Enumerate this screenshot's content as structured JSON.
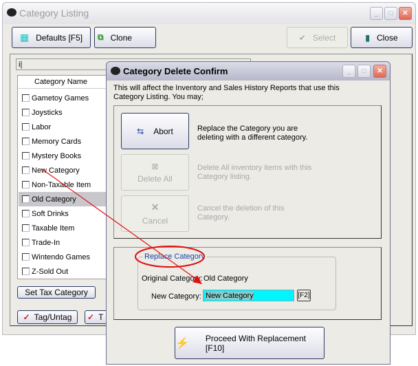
{
  "main_window": {
    "title": "Category Listing",
    "toolbar": {
      "defaults": "Defaults [F5]",
      "clone": "Clone",
      "select": "Select",
      "close": "Close"
    },
    "search_value": "i|",
    "column_header": "Category Name",
    "categories": [
      "Gametoy Games",
      "Joysticks",
      "Labor",
      "Memory Cards",
      "Mystery Books",
      "New Category",
      "Non-Taxable Item",
      "Old Category",
      "Soft Drinks",
      "Taxable Item",
      "Trade-In",
      "Wintendo Games",
      "Z-Sold Out"
    ],
    "selected_category": "Old Category",
    "set_tax_category": "Set Tax Category",
    "tag_untag": "Tag/Untag",
    "tag_second": "T"
  },
  "dialog": {
    "title": "Category Delete Confirm",
    "message": "This will affect the Inventory and Sales History Reports that use this Category Listing.  You may;",
    "options": [
      {
        "label": "Abort",
        "description": "Replace the Category you are deleting with a different category.",
        "enabled": true
      },
      {
        "label": "Delete All",
        "description": "Delete All inventory items with this Category listing.",
        "enabled": false
      },
      {
        "label": "Cancel",
        "description": "Cancel the deletion of this Category.",
        "enabled": false
      }
    ],
    "group_title": "Replace Category",
    "original_label": "Original Category:",
    "original_value": "Old Category",
    "new_label": "New Category:",
    "new_value": "New Category",
    "f2": "[F2]",
    "proceed": "Proceed With Replacement [F10]"
  },
  "colors": {
    "input_highlight": "#00f6ff",
    "annotation": "#e01010",
    "group_title": "#1a3fa0"
  }
}
